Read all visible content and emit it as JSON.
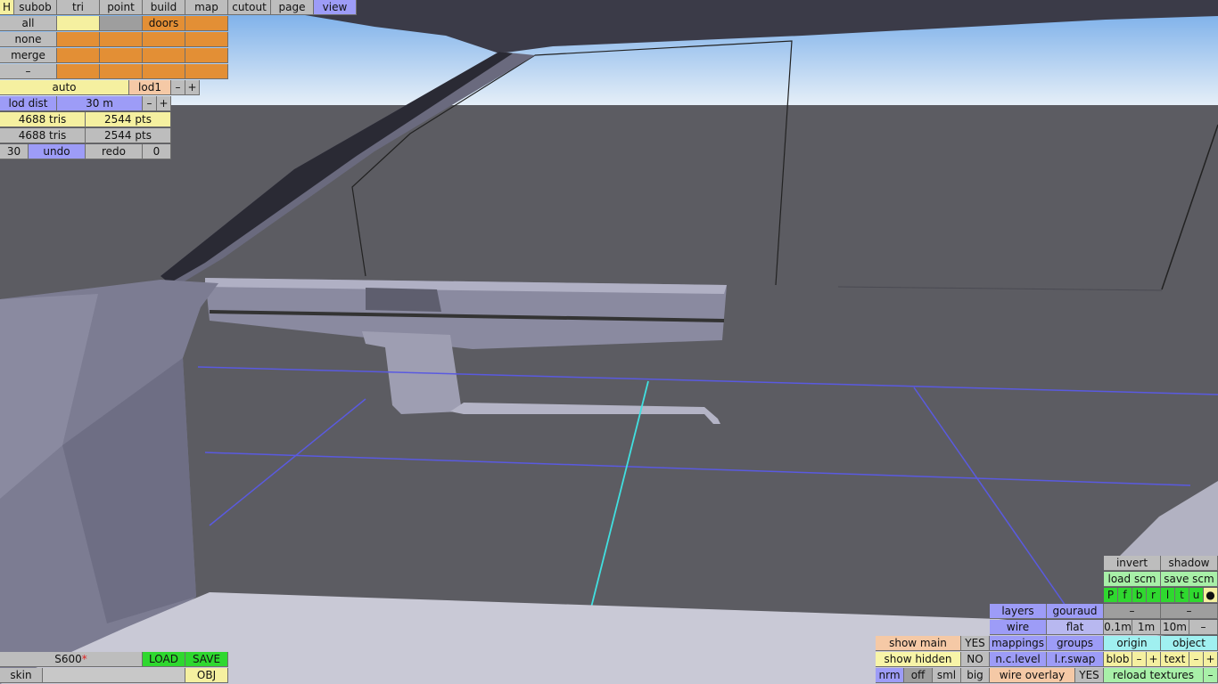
{
  "colors": {
    "sky_top": "#6fa8e8",
    "sky_bottom": "#e7f0f8",
    "ground": "#5c5c62",
    "car_body": "#7a7a90",
    "grid_line": "#5a5ae0",
    "axis_line": "#40e0e0"
  },
  "top_tabs": {
    "h": "H",
    "subob": "subob",
    "tri": "tri",
    "point": "point",
    "build": "build",
    "map": "map",
    "cutout": "cutout",
    "page": "page",
    "view": "view"
  },
  "select": {
    "all": "all",
    "none": "none",
    "merge": "merge",
    "minus": "–",
    "doors": "doors"
  },
  "lod": {
    "auto": "auto",
    "level": "lod1",
    "minus": "–",
    "plus": "+",
    "dist_label": "lod dist",
    "dist_value": "30 m",
    "dist_minus": "–",
    "dist_plus": "+"
  },
  "stats": {
    "tris_1": "4688 tris",
    "pts_1": "2544 pts",
    "tris_2": "4688 tris",
    "pts_2": "2544 pts"
  },
  "history": {
    "undo_count": "30",
    "undo": "undo",
    "redo": "redo",
    "redo_count": "0"
  },
  "file": {
    "name": "S600",
    "modified_mark": "*",
    "load": "LOAD",
    "save": "SAVE",
    "skin": "skin",
    "obj": "OBJ"
  },
  "view_panel": {
    "invert": "invert",
    "shadow": "shadow",
    "load_scm": "load scm",
    "save_scm": "save scm",
    "flags": [
      "P",
      "f",
      "b",
      "r",
      "l",
      "t",
      "u",
      "●"
    ],
    "dash_a": "–",
    "dash_b": "–",
    "layers": "layers",
    "gouraud": "gouraud",
    "wire": "wire",
    "flat": "flat",
    "grid_01": "0.1m",
    "grid_1": "1m",
    "grid_10": "10m",
    "grid_minus": "–",
    "show_main": "show main",
    "show_main_val": "YES",
    "mappings": "mappings",
    "groups": "groups",
    "origin": "origin",
    "object": "object",
    "show_hidden": "show hidden",
    "show_hidden_val": "NO",
    "nc_level": "n.c.level",
    "lr_swap": "l.r.swap",
    "blob": "blob",
    "blob_minus": "–",
    "blob_plus": "+",
    "text": "text",
    "text_minus": "–",
    "text_plus": "+",
    "nrm": "nrm",
    "off": "off",
    "sml": "sml",
    "big": "big",
    "wire_overlay": "wire overlay",
    "wire_overlay_val": "YES",
    "reload_textures": "reload textures",
    "reload_minus": "–"
  }
}
